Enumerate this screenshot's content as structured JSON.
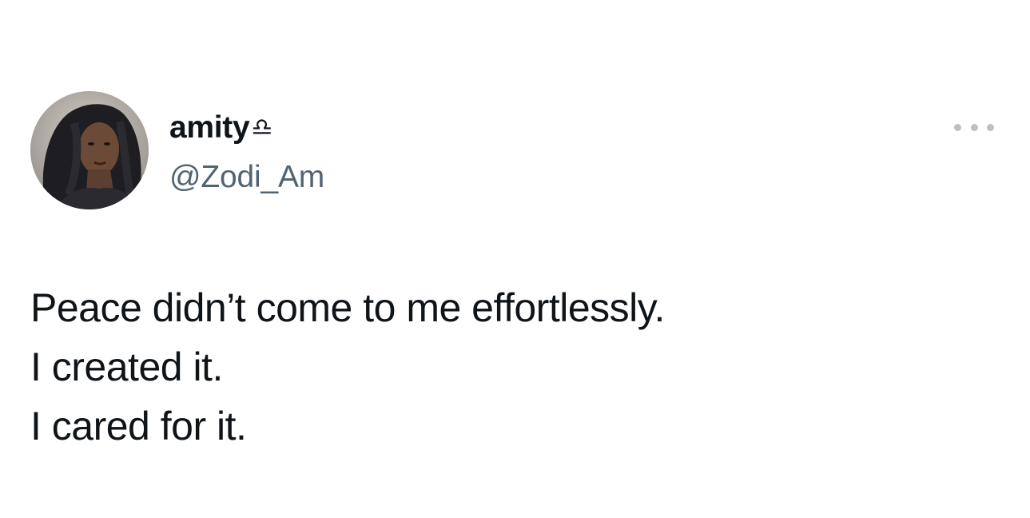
{
  "tweet": {
    "author": {
      "display_name": "amity",
      "name_emoji": "♎",
      "handle": "@Zodi_Am",
      "avatar_icon": "profile-photo"
    },
    "more_icon": "more-horizontal-icon",
    "text_lines": [
      "Peace didn’t come to me effortlessly.",
      "I created it.",
      "I cared for it."
    ]
  },
  "colors": {
    "text_primary": "#0f1419",
    "text_secondary": "#536471",
    "icon_muted": "#b9c1c8",
    "background": "#ffffff"
  }
}
